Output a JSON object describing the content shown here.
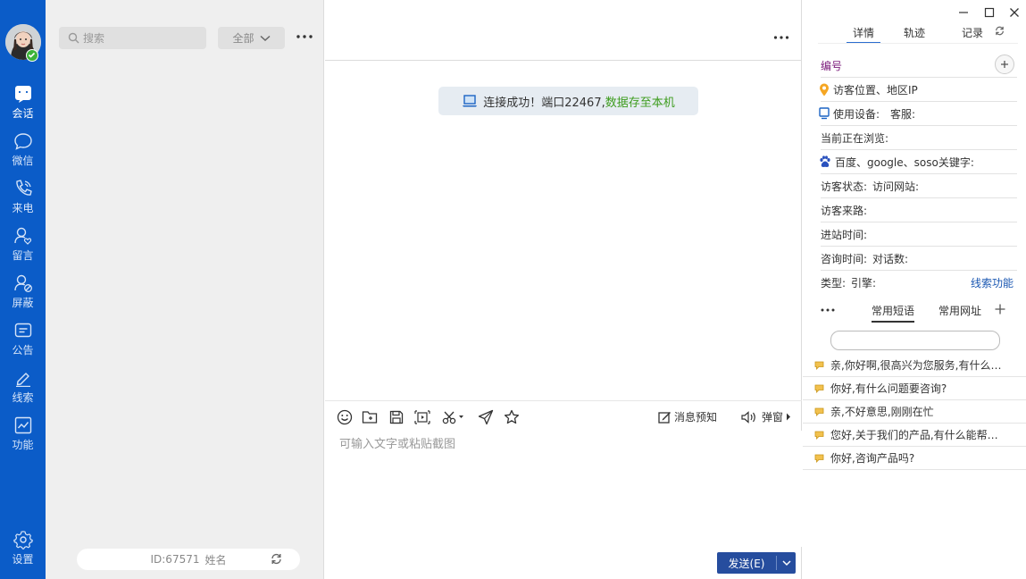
{
  "nav": {
    "items": [
      {
        "label": "会话",
        "icon": "chat-bubble-icon"
      },
      {
        "label": "微信",
        "icon": "wechat-icon"
      },
      {
        "label": "来电",
        "icon": "phone-icon"
      },
      {
        "label": "留言",
        "icon": "message-user-icon"
      },
      {
        "label": "屏蔽",
        "icon": "block-user-icon"
      },
      {
        "label": "公告",
        "icon": "announcement-icon"
      },
      {
        "label": "线索",
        "icon": "pen-icon"
      },
      {
        "label": "功能",
        "icon": "chart-icon"
      }
    ],
    "settings": {
      "label": "设置",
      "icon": "gear-icon"
    }
  },
  "list": {
    "search_placeholder": "搜索",
    "filter_label": "全部",
    "id_label": "ID:67571",
    "name_label": "姓名"
  },
  "chat": {
    "notice_main": "连接成功！端口22467,",
    "notice_green": "数据存至本机",
    "toolbar": {
      "msg_preview": "消息预知",
      "popup": "弹窗"
    },
    "input_placeholder": "可输入文字或粘贴截图",
    "send_label": "发送(E)"
  },
  "panel": {
    "tabs": [
      "详情",
      "轨迹",
      "记录"
    ],
    "rows": {
      "number": "编号",
      "location": "访客位置、地区IP",
      "device": "使用设备:",
      "agent": "客服:",
      "browsing": "当前正在浏览:",
      "keywords": "百度、google、soso关键字:",
      "status": "访客状态:",
      "site": "访问网站:",
      "source": "访客来路:",
      "enter_time": "进站时间:",
      "consult_time": "咨询时间:",
      "dialogs": "对话数:",
      "type": "类型:",
      "engine": "引擎:",
      "lead_link": "线索功能"
    },
    "phrase_tabs": [
      "常用短语",
      "常用网址"
    ],
    "phrases": [
      "亲,你好啊,很高兴为您服务,有什么可以帮您",
      "你好,有什么问题要咨询?",
      "亲,不好意思,刚刚在忙",
      "您好,关于我们的产品,有什么能帮到您的吗",
      "你好,咨询产品吗?"
    ]
  },
  "colors": {
    "nav_bg": "#0b5cc8",
    "send_bg": "#264d9e",
    "notice_green": "#3d9c1e",
    "link_blue": "#1a57b2"
  }
}
